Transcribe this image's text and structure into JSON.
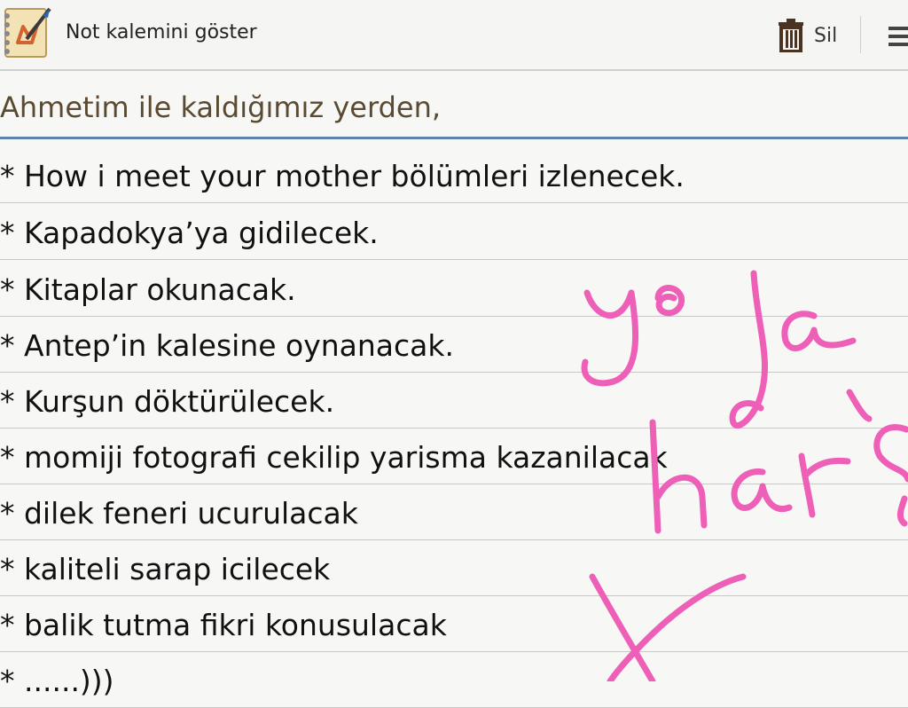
{
  "toolbar": {
    "app_icon": "notebook-pen-icon",
    "show_pen_label": "Not kalemini göster",
    "delete_label": "Sil",
    "delete_icon": "trash-icon",
    "menu_icon": "overflow-menu-icon"
  },
  "note": {
    "title": "Ahmetim ile kaldığımız yerden,",
    "lines": [
      "* How i meet your mother bölümleri izlenecek.",
      "* Kapadokya’ya gidilecek.",
      "* Kitaplar okunacak.",
      "* Antep’in kalesine oynanacak.",
      "* Kurşun döktürülecek.",
      " * momiji fotografi cekilip yarisma kazanilacak",
      " * dilek feneri ucurulacak",
      "* kaliteli sarap icilecek",
      " * balik tutma fikri konusulacak",
      "* ......)))"
    ]
  },
  "colors": {
    "handwriting": "#ee5fb7",
    "title_text": "#5a4a32",
    "title_rule": "#5f83a8"
  }
}
